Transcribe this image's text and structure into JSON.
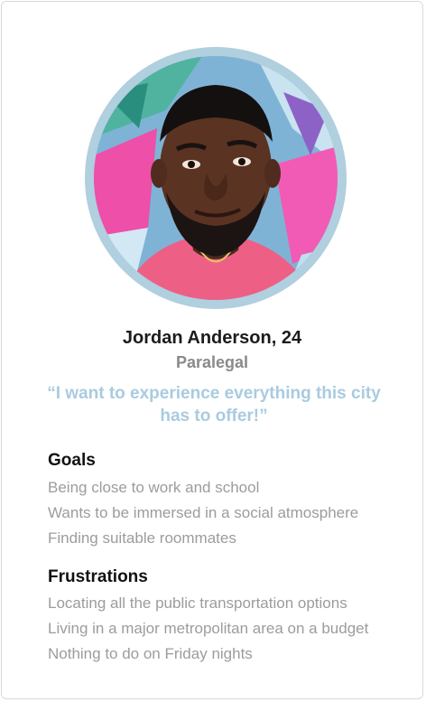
{
  "persona": {
    "name": "Jordan Anderson, 24",
    "role": "Paralegal",
    "quote": "“I want to experience everything this city has to offer!”",
    "ring_color": "#b0cfdf",
    "quote_color": "#a9cbe0"
  },
  "goals": {
    "title": "Goals",
    "items": [
      "Being close to work and school",
      "Wants to be immersed in a social atmosphere",
      "Finding suitable roommates"
    ]
  },
  "frustrations": {
    "title": "Frustrations",
    "items": [
      "Locating all the public transportation options",
      "Living in a major metropolitan area on a budget",
      "Nothing to do on Friday nights"
    ]
  }
}
